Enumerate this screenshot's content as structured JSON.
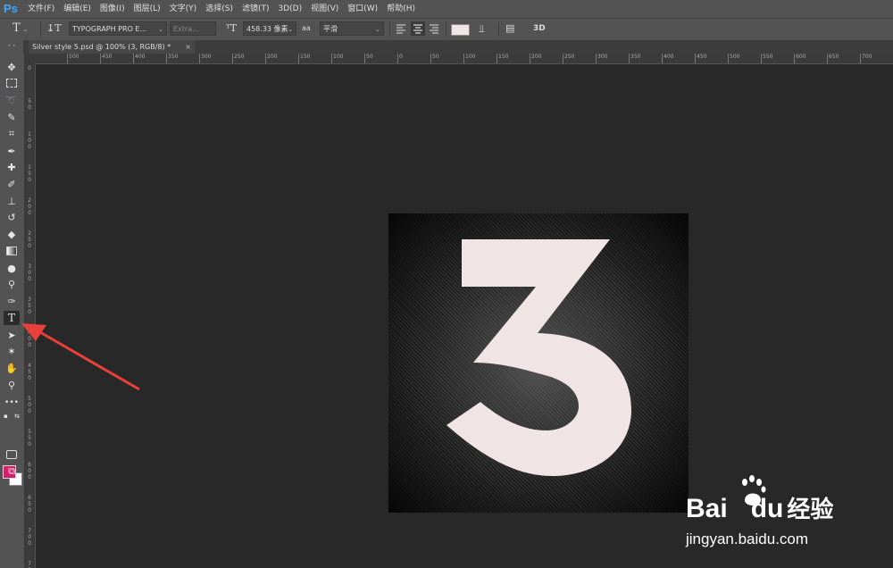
{
  "app": {
    "logo": "Ps"
  },
  "menu": [
    "文件(F)",
    "编辑(E)",
    "图像(I)",
    "图层(L)",
    "文字(Y)",
    "选择(S)",
    "滤镜(T)",
    "3D(D)",
    "视图(V)",
    "窗口(W)",
    "帮助(H)"
  ],
  "options": {
    "font_family": "TYPOGRAPH PRO E...",
    "font_style_placeholder": "Extra...",
    "font_size": "458.33 像素",
    "aa_label": "aa",
    "anti_alias": "平滑",
    "text_color": "#f0e4e4",
    "threed_label": "3D"
  },
  "document": {
    "tab_title": "Silver style 5.psd @ 100% (3, RGB/8) *",
    "close": "×",
    "glyph": "3",
    "glyph_color": "#f0e4e4"
  },
  "ruler_h_ticks": [
    "500",
    "450",
    "400",
    "350",
    "300",
    "250",
    "200",
    "150",
    "100",
    "50",
    "0",
    "50",
    "100",
    "150",
    "200",
    "250",
    "300",
    "350",
    "400",
    "450",
    "500",
    "550",
    "600",
    "650",
    "700",
    "750"
  ],
  "ruler_v_ticks": [
    "0",
    "5\n0",
    "1\n0\n0",
    "1\n5\n0",
    "2\n0\n0",
    "2\n5\n0",
    "3\n0\n0",
    "3\n5\n0",
    "4\n0\n0",
    "4\n5\n0",
    "5\n0\n0",
    "5\n5\n0",
    "6\n0\n0",
    "6\n5\n0",
    "7\n0\n0",
    "7\n5\n0"
  ],
  "colors": {
    "foreground": "#d0216b",
    "background": "#ffffff",
    "annotation_arrow": "#e8403a"
  },
  "watermark": {
    "brand_a": "Bai",
    "brand_b": "du",
    "brand_c": "经验",
    "url": "jingyan.baidu.com"
  }
}
